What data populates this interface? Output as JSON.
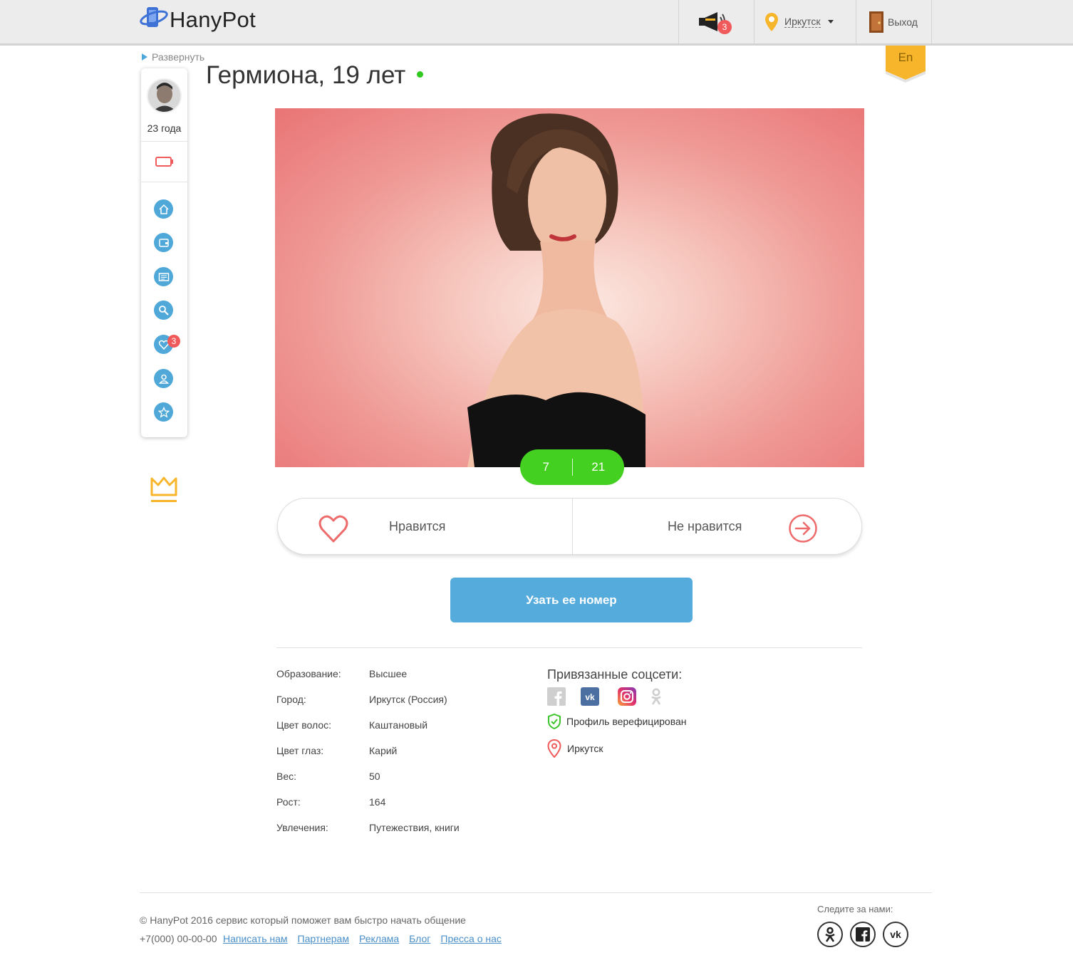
{
  "brand": {
    "name": "HanyPot"
  },
  "header": {
    "notifications_count": "3",
    "city": "Иркутск",
    "logout_label": "Выход",
    "language": "En"
  },
  "sidebar": {
    "expand_label": "Развернуть",
    "user_age": "23 года",
    "likes_badge": "3",
    "nav_icons": [
      "home-icon",
      "wallet-icon",
      "messages-icon",
      "search-icon",
      "heart-icon",
      "user-icon",
      "star-icon"
    ]
  },
  "profile": {
    "title": "Гермиона, 19 лет",
    "photo_current": "7",
    "photo_total": "21",
    "like_label": "Нравится",
    "dislike_label": "Не нравится",
    "cta_label": "Узать ее номер",
    "details": [
      {
        "label": "Образование:",
        "value": "Высшее"
      },
      {
        "label": "Город:",
        "value": "Иркутск (Россия)"
      },
      {
        "label": "Цвет волос:",
        "value": "Каштановый"
      },
      {
        "label": "Цвет глаз:",
        "value": "Карий"
      },
      {
        "label": "Вес:",
        "value": "50"
      },
      {
        "label": "Рост:",
        "value": "164"
      },
      {
        "label": "Увлечения:",
        "value": "Путежествия, книги"
      }
    ],
    "social_title": "Привязанные соцсети:",
    "verified_label": "Профиль верефицирован",
    "location": "Иркутск"
  },
  "footer": {
    "copyright": "© HanyPot 2016 сервис который поможет вам быстро начать общение",
    "phone": "+7(000) 00-00-00",
    "links": [
      "Написать нам",
      "Партнерам",
      "Реклама",
      "Блог",
      "Пресса о нас"
    ],
    "follow_label": "Следите за нами:"
  },
  "colors": {
    "accent_blue": "#55abdb",
    "green": "#44d020",
    "red": "#f05a5a",
    "gold": "#f7b52c"
  }
}
